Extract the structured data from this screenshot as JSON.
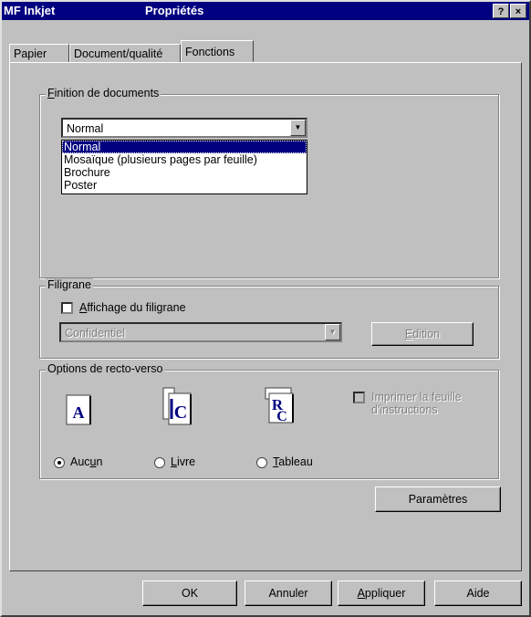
{
  "window": {
    "title_app": "MF Inkjet",
    "title_props": "Propriétés",
    "help_button": "?",
    "close_button": "×"
  },
  "tabs": [
    {
      "label": "Papier"
    },
    {
      "label": "Document/qualité"
    },
    {
      "label": "Fonctions"
    }
  ],
  "finition": {
    "legend_first": "F",
    "legend_rest": "inition de documents",
    "selected": "Normal",
    "options": [
      "Normal",
      "Mosaïque (plusieurs pages par feuille)",
      "Brochure",
      "Poster"
    ]
  },
  "filigrane": {
    "legend": "Filigrane",
    "checkbox_first": "A",
    "checkbox_rest": "ffichage du filigrane",
    "combo_value": "Confidentiel",
    "edit_first": "E",
    "edit_rest": "dition"
  },
  "recto": {
    "legend": "Options de recto-verso",
    "radio_aucun_pre": "Auc",
    "radio_aucun_u": "u",
    "radio_aucun_post": "n",
    "radio_livre_first": "L",
    "radio_livre_rest": "ivre",
    "radio_tableau_first": "T",
    "radio_tableau_rest": "ableau",
    "checkbox_line1": "Imprimer la feuille",
    "checkbox_line2": "d'instructions",
    "icon_a": "A",
    "icon_c": "C",
    "icon_r": "R"
  },
  "buttons": {
    "parametres": "Paramètres",
    "ok": "OK",
    "annuler": "Annuler",
    "appliquer_first": "A",
    "appliquer_rest": "ppliquer",
    "aide": "Aide"
  },
  "colors": {
    "titlebar": "#000080",
    "face": "#c0c0c0",
    "selection": "#000080"
  }
}
